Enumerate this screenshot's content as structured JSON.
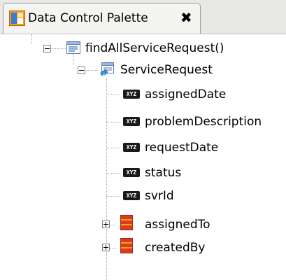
{
  "tab": {
    "title": "Data Control Palette",
    "close_glyph": "✖",
    "icon": "palette-icon"
  },
  "tree": {
    "method": {
      "label": "findAllServiceRequest()",
      "icon": "method-icon",
      "expanded": true
    },
    "collection": {
      "label": "ServiceRequest",
      "icon": "collection-icon",
      "expanded": true
    },
    "attributes": [
      {
        "label": "assignedDate",
        "icon": "attribute-icon",
        "badge": "XYZ"
      },
      {
        "label": "problemDescription",
        "icon": "attribute-icon",
        "badge": "XYZ"
      },
      {
        "label": "requestDate",
        "icon": "attribute-icon",
        "badge": "XYZ"
      },
      {
        "label": "status",
        "icon": "attribute-icon",
        "badge": "XYZ"
      },
      {
        "label": "svrId",
        "icon": "attribute-icon",
        "badge": "XYZ"
      }
    ],
    "accessors": [
      {
        "label": "assignedTo",
        "icon": "accessor-icon",
        "expanded": false
      },
      {
        "label": "createdBy",
        "icon": "accessor-icon",
        "expanded": false
      }
    ]
  },
  "colors": {
    "tab_background": "#f4f4f2",
    "tabbar_background": "#e8e8e6",
    "tree_guide": "#a6a6a6",
    "accessor_red": "#e03a1e",
    "accessor_orange": "#f6a21c"
  }
}
